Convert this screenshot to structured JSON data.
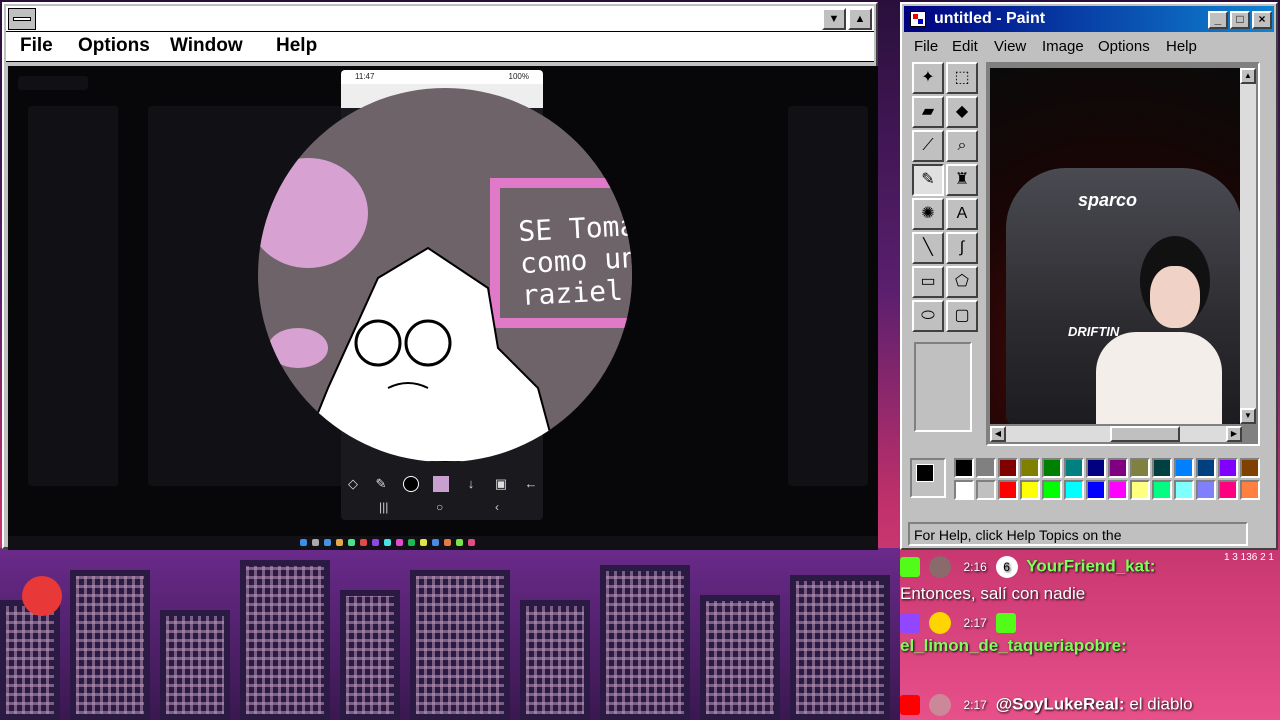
{
  "left_window": {
    "menu": [
      "File",
      "Options",
      "Window",
      "Help"
    ],
    "title_buttons": [
      "▼",
      "▲"
    ]
  },
  "phone": {
    "status_time": "11:47",
    "status_battery": "100%",
    "speech_text": "SE Toma\ncomo un\nraziel",
    "nav": [
      "|||",
      "○",
      "‹"
    ]
  },
  "paint": {
    "title": "untitled - Paint",
    "menu": [
      "File",
      "Edit",
      "View",
      "Image",
      "Options",
      "Help"
    ],
    "tools": [
      {
        "name": "free-select-icon",
        "glyph": "✦"
      },
      {
        "name": "rect-select-icon",
        "glyph": "⬚"
      },
      {
        "name": "eraser-icon",
        "glyph": "▰"
      },
      {
        "name": "fill-icon",
        "glyph": "◆"
      },
      {
        "name": "pick-color-icon",
        "glyph": "⟋"
      },
      {
        "name": "magnifier-icon",
        "glyph": "⌕"
      },
      {
        "name": "pencil-icon",
        "glyph": "✎"
      },
      {
        "name": "brush-icon",
        "glyph": "♜"
      },
      {
        "name": "airbrush-icon",
        "glyph": "✺"
      },
      {
        "name": "text-icon",
        "glyph": "A"
      },
      {
        "name": "line-icon",
        "glyph": "╲"
      },
      {
        "name": "curve-icon",
        "glyph": "∫"
      },
      {
        "name": "rectangle-icon",
        "glyph": "▭"
      },
      {
        "name": "polygon-icon",
        "glyph": "⬠"
      },
      {
        "name": "ellipse-icon",
        "glyph": "⬭"
      },
      {
        "name": "rounded-rect-icon",
        "glyph": "▢"
      }
    ],
    "canvas_logo": "sparco",
    "canvas_logo2": "DRIFTIN",
    "status": "For Help, click Help Topics on the",
    "palette_top": [
      "#000000",
      "#808080",
      "#800000",
      "#808000",
      "#008000",
      "#008080",
      "#000080",
      "#800080",
      "#808040",
      "#004040",
      "#0080ff",
      "#004080",
      "#8000ff",
      "#804000"
    ],
    "palette_bottom": [
      "#ffffff",
      "#c0c0c0",
      "#ff0000",
      "#ffff00",
      "#00ff00",
      "#00ffff",
      "#0000ff",
      "#ff00ff",
      "#ffff80",
      "#00ff80",
      "#80ffff",
      "#8080ff",
      "#ff0080",
      "#ff8040"
    ]
  },
  "chat": {
    "stats": "1  3  136  2  1",
    "messages": [
      {
        "time": "2:16",
        "count": "6",
        "user": "YourFriend_kat:",
        "text": ""
      },
      {
        "time": "",
        "count": "",
        "user": "",
        "text": "Entonces, salí con nadie"
      },
      {
        "time": "2:17",
        "count": "",
        "user": "",
        "text": ""
      },
      {
        "time": "",
        "count": "",
        "user": "el_limon_de_taqueriapobre:",
        "text": ""
      },
      {
        "time": "2:17",
        "count": "",
        "user": "@SoyLukeReal:",
        "text": "el diablo"
      }
    ]
  }
}
